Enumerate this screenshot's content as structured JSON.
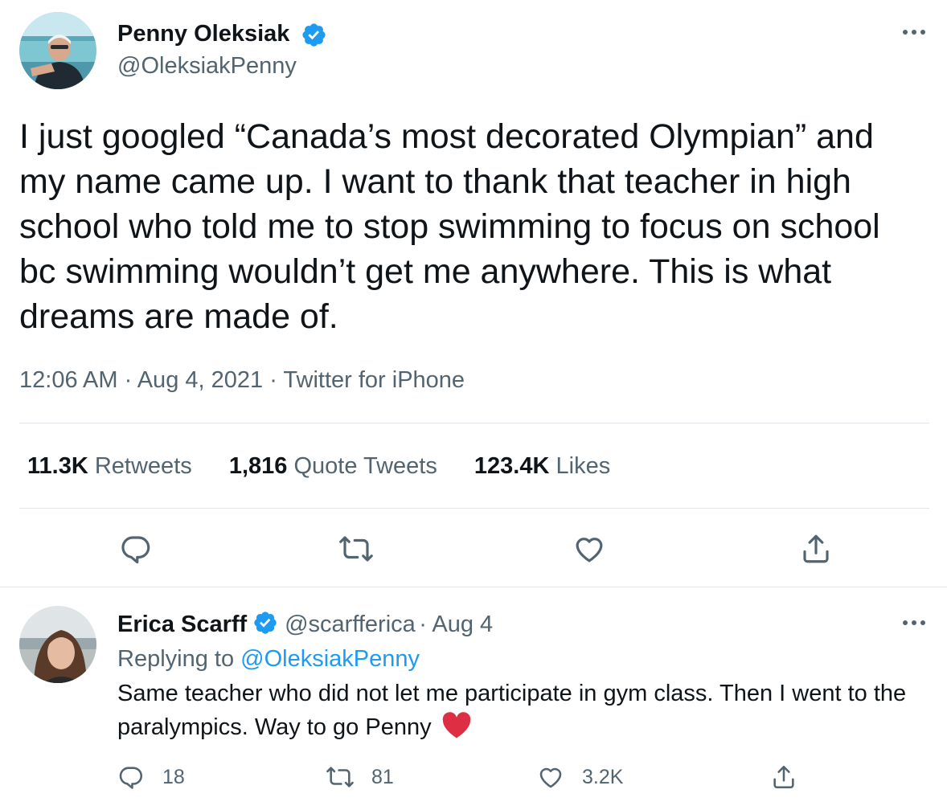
{
  "tweet": {
    "author_name": "Penny Oleksiak",
    "author_handle": "@OleksiakPenny",
    "text": "I just googled “Canada’s most decorated Olympian” and my name came up. I want to thank that teacher in high school who told me to stop swimming to focus on school bc swimming wouldn’t get me anywhere. This is what dreams are made of.",
    "time": "12:06 AM",
    "date": "Aug 4, 2021",
    "source": "Twitter for iPhone",
    "retweets_count": "11.3K",
    "retweets_label": "Retweets",
    "quotes_count": "1,816",
    "quotes_label": "Quote Tweets",
    "likes_count": "123.4K",
    "likes_label": "Likes",
    "more_icon": "more-icon",
    "verified_icon": "verified-badge-icon"
  },
  "reply": {
    "author_name": "Erica Scarff",
    "author_handle": "@scarfferica",
    "date": "· Aug 4",
    "replying_prefix": "Replying to",
    "replying_handle": "@OleksiakPenny",
    "text": "Same teacher who did not let me participate in gym class. Then I went to the paralympics. Way to go Penny",
    "emoji": "heart-emoji",
    "reply_count": "18",
    "retweet_count": "81",
    "like_count": "3.2K"
  },
  "colors": {
    "accent": "#1d9bf0",
    "text": "#0f1419",
    "muted": "#536471",
    "divider": "#e1e6ea",
    "heart": "#e0245e"
  }
}
